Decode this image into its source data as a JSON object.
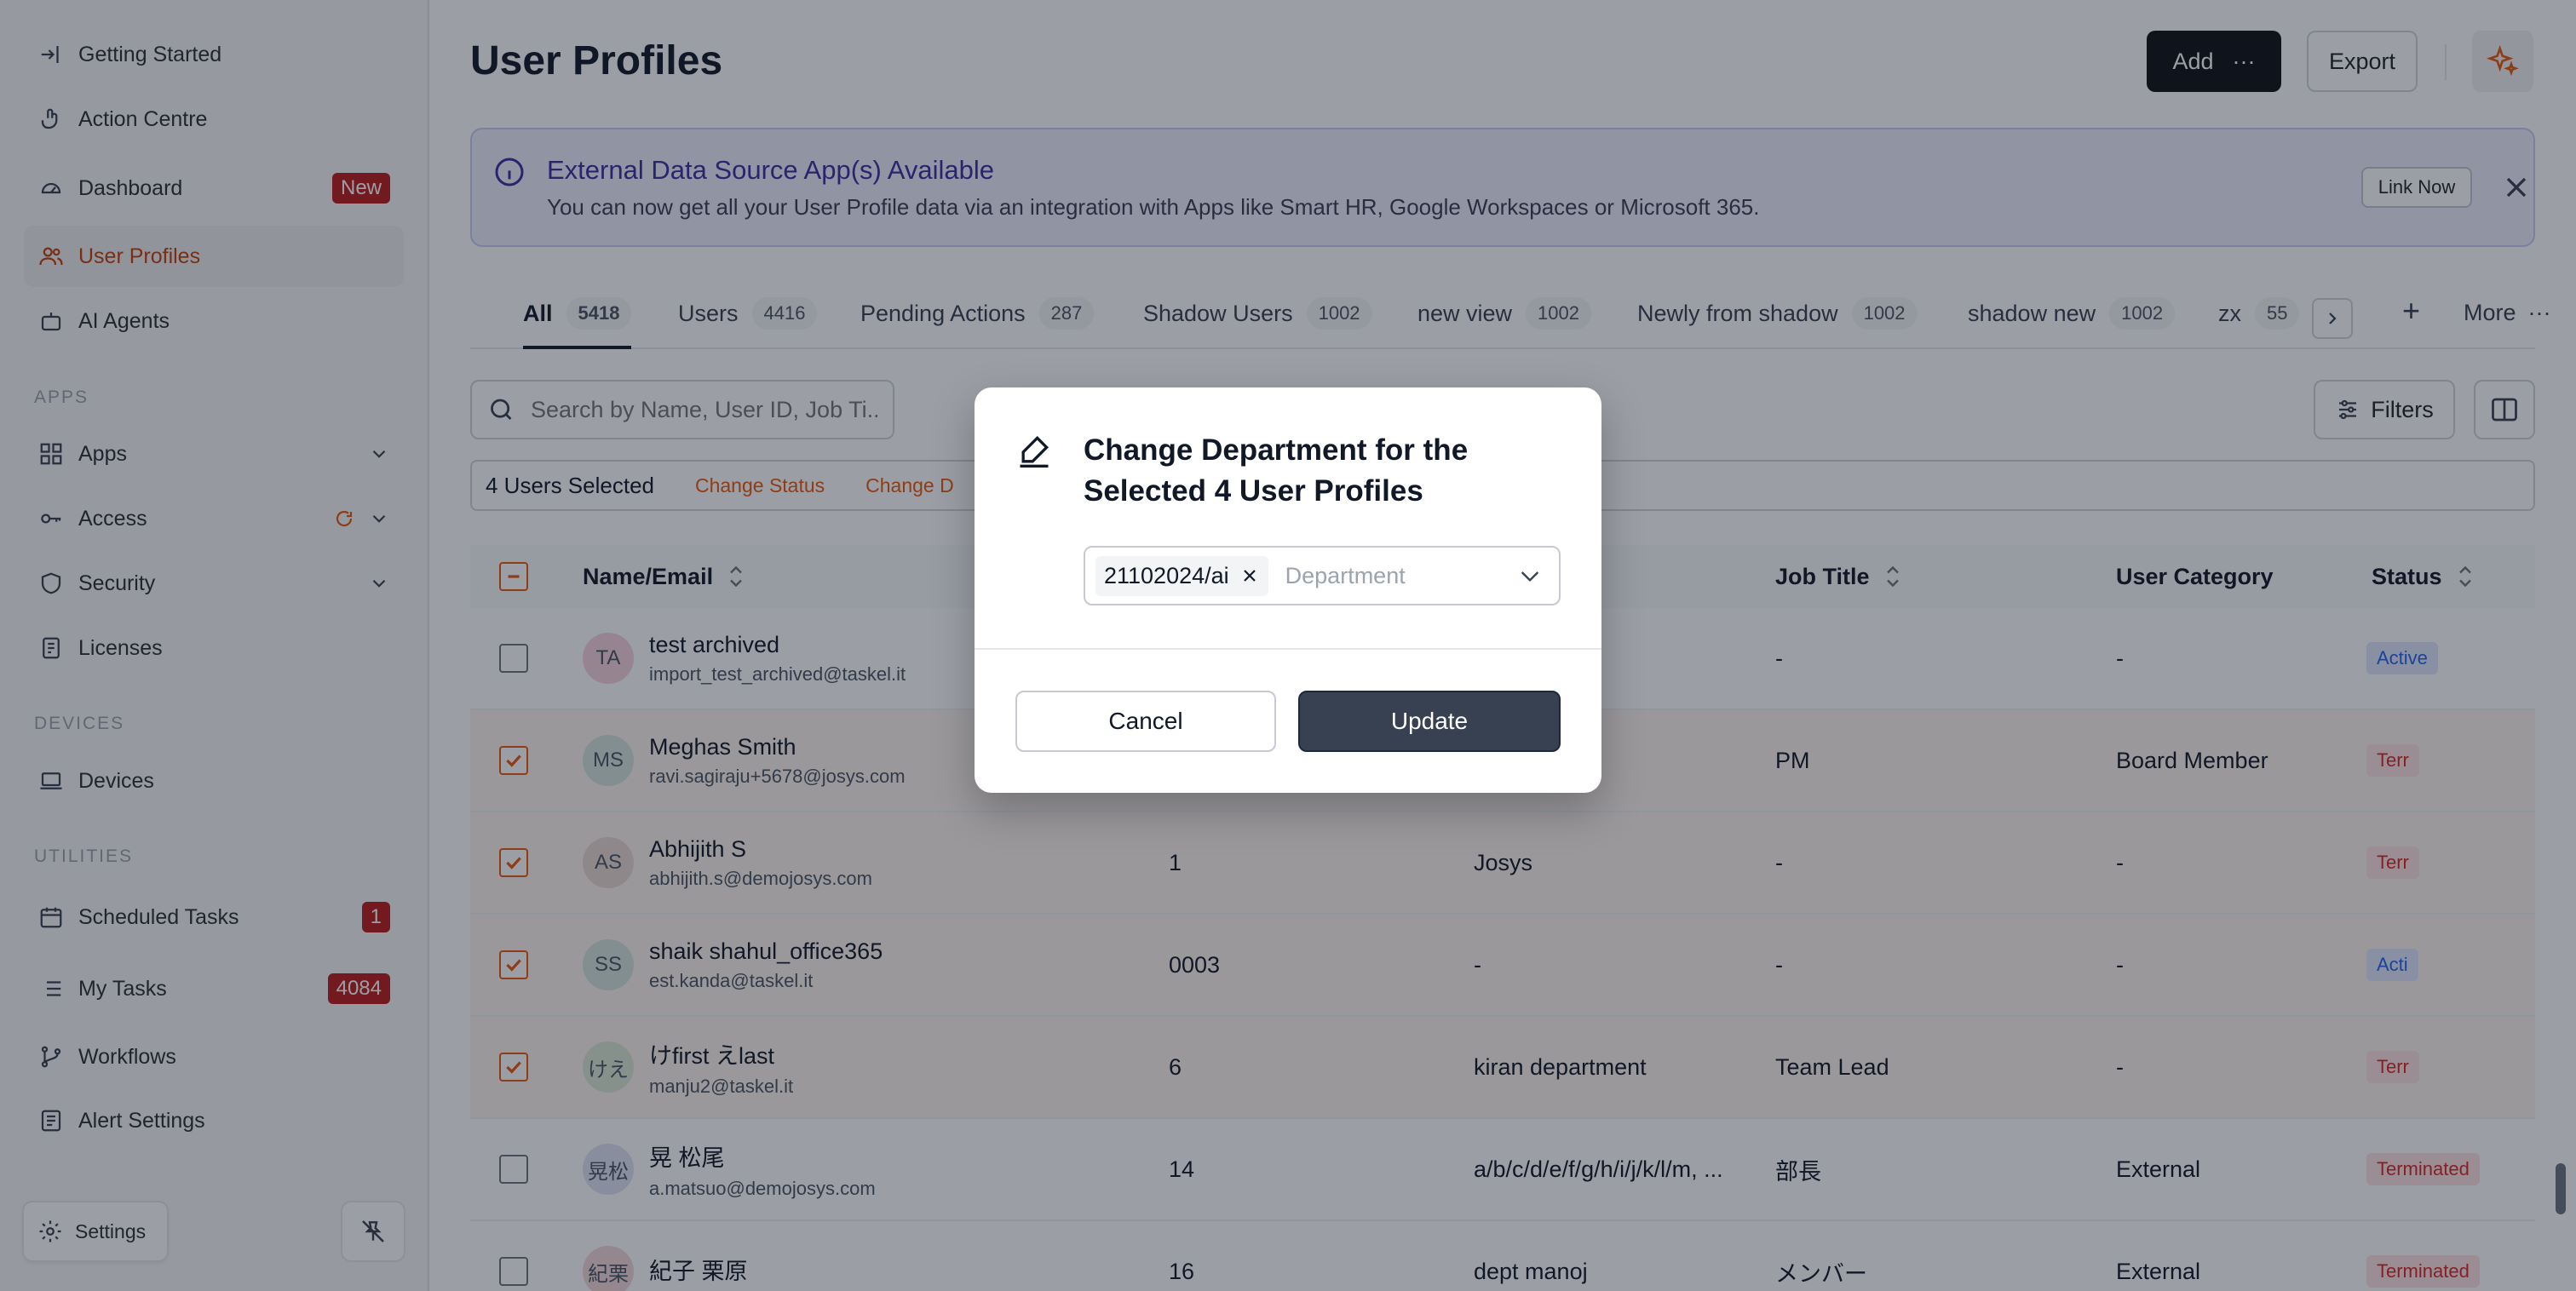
{
  "sidebar": {
    "items_top": [
      {
        "label": "Getting Started",
        "icon": "arrow-in-icon"
      },
      {
        "label": "Action Centre",
        "icon": "hand-pointer-icon"
      },
      {
        "label": "Dashboard",
        "icon": "gauge-icon",
        "badge": "New"
      },
      {
        "label": "User Profiles",
        "icon": "users-icon",
        "active": true
      },
      {
        "label": "AI Agents",
        "icon": "robot-icon"
      }
    ],
    "section_apps": "APPS",
    "items_apps": [
      {
        "label": "Apps",
        "icon": "grid-icon"
      },
      {
        "label": "Access",
        "icon": "key-icon"
      },
      {
        "label": "Security",
        "icon": "shield-icon"
      },
      {
        "label": "Licenses",
        "icon": "license-icon"
      }
    ],
    "section_devices": "DEVICES",
    "items_devices": [
      {
        "label": "Devices",
        "icon": "laptop-icon"
      }
    ],
    "section_utilities": "UTILITIES",
    "items_utilities": [
      {
        "label": "Scheduled Tasks",
        "icon": "calendar-icon",
        "badge": "1"
      },
      {
        "label": "My Tasks",
        "icon": "list-icon",
        "badge": "4084"
      },
      {
        "label": "Workflows",
        "icon": "branch-icon"
      },
      {
        "label": "Alert Settings",
        "icon": "alert-icon"
      }
    ],
    "settings_label": "Settings"
  },
  "header": {
    "title": "User Profiles",
    "add_label": "Add",
    "export_label": "Export"
  },
  "banner": {
    "title": "External Data Source App(s) Available",
    "text": "You can now get all your User Profile data via an integration with Apps like Smart HR, Google Workspaces or Microsoft 365.",
    "link_label": "Link Now"
  },
  "tabs": [
    {
      "label": "All",
      "count": "5418",
      "active": true
    },
    {
      "label": "Users",
      "count": "4416"
    },
    {
      "label": "Pending Actions",
      "count": "287"
    },
    {
      "label": "Shadow Users",
      "count": "1002"
    },
    {
      "label": "new view",
      "count": "1002"
    },
    {
      "label": "Newly from shadow",
      "count": "1002"
    },
    {
      "label": "shadow new",
      "count": "1002"
    },
    {
      "label": "zx",
      "count": "55"
    }
  ],
  "tabs_more": "More",
  "search": {
    "placeholder": "Search by Name, User ID, Job Ti..."
  },
  "filters_label": "Filters",
  "selection": {
    "count_label": "4 Users Selected",
    "actions": [
      "Change Status",
      "Change D"
    ]
  },
  "table": {
    "columns": [
      "Name/Email",
      "Job Title",
      "User Category",
      "Status"
    ],
    "rows": [
      {
        "initials": "TA",
        "name": "test archived",
        "email": "import_test_archived@taskel.it",
        "id": "",
        "dept": "",
        "job": "-",
        "category": "-",
        "status": "Active",
        "checked": false,
        "avatar_color": "#f7d4dc"
      },
      {
        "initials": "MS",
        "name": "Meghas Smith",
        "email": "ravi.sagiraju+5678@josys.com",
        "id": "",
        "dept": "",
        "job": "PM",
        "category": "Board Member",
        "status": "Terr",
        "checked": true,
        "avatar_color": "#d6e4dc"
      },
      {
        "initials": "AS",
        "name": "Abhijith S",
        "email": "abhijith.s@demojosys.com",
        "id": "1",
        "dept": "Josys",
        "job": "-",
        "category": "-",
        "status": "Terr",
        "checked": true,
        "avatar_color": "#ead9d2"
      },
      {
        "initials": "SS",
        "name": "shaik shahul_office365",
        "email": "est.kanda@taskel.it",
        "id": "0003",
        "dept": "-",
        "job": "-",
        "category": "-",
        "status": "Acti",
        "checked": true,
        "avatar_color": "#d6e4dc"
      },
      {
        "initials": "けえ",
        "name": "けfirst えlast",
        "email": "manju2@taskel.it",
        "id": "6",
        "dept": "kiran department",
        "job": "Team Lead",
        "category": "-",
        "status": "Terr",
        "checked": true,
        "avatar_color": "#dce8d6"
      },
      {
        "initials": "晃松",
        "name": "晃 松尾",
        "email": "a.matsuo@demojosys.com",
        "id": "14",
        "dept": "a/b/c/d/e/f/g/h/i/j/k/l/m, ...",
        "job": "部長",
        "category": "External",
        "status": "Terminated",
        "checked": false,
        "avatar_color": "#dfe3f5"
      },
      {
        "initials": "紀栗",
        "name": "紀子 栗原",
        "email": "",
        "id": "16",
        "dept": "dept manoj",
        "job": "メンバー",
        "category": "External",
        "status": "Terminated",
        "checked": false,
        "avatar_color": "#f3d8d8"
      }
    ]
  },
  "modal": {
    "title": "Change Department for the Selected 4 User Profiles",
    "chip_value": "21102024/ai",
    "placeholder": "Department",
    "cancel_label": "Cancel",
    "update_label": "Update"
  }
}
